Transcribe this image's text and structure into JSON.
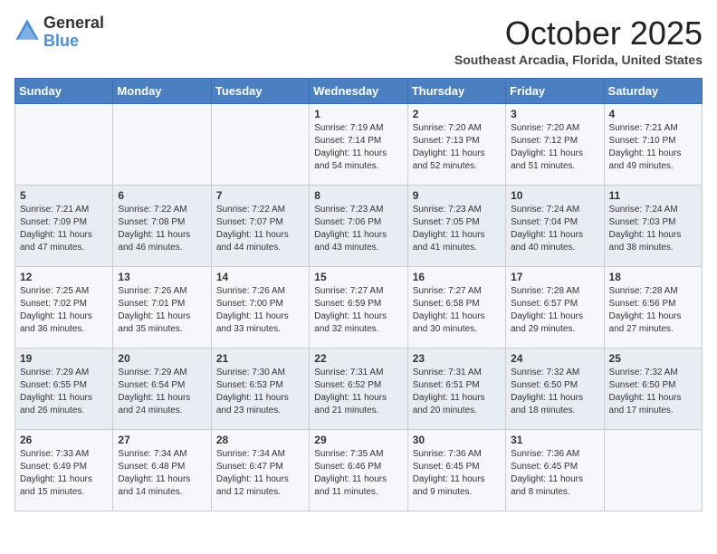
{
  "logo": {
    "general": "General",
    "blue": "Blue"
  },
  "title": "October 2025",
  "location": "Southeast Arcadia, Florida, United States",
  "days_of_week": [
    "Sunday",
    "Monday",
    "Tuesday",
    "Wednesday",
    "Thursday",
    "Friday",
    "Saturday"
  ],
  "weeks": [
    [
      {
        "day": "",
        "info": ""
      },
      {
        "day": "",
        "info": ""
      },
      {
        "day": "",
        "info": ""
      },
      {
        "day": "1",
        "info": "Sunrise: 7:19 AM\nSunset: 7:14 PM\nDaylight: 11 hours and 54 minutes."
      },
      {
        "day": "2",
        "info": "Sunrise: 7:20 AM\nSunset: 7:13 PM\nDaylight: 11 hours and 52 minutes."
      },
      {
        "day": "3",
        "info": "Sunrise: 7:20 AM\nSunset: 7:12 PM\nDaylight: 11 hours and 51 minutes."
      },
      {
        "day": "4",
        "info": "Sunrise: 7:21 AM\nSunset: 7:10 PM\nDaylight: 11 hours and 49 minutes."
      }
    ],
    [
      {
        "day": "5",
        "info": "Sunrise: 7:21 AM\nSunset: 7:09 PM\nDaylight: 11 hours and 47 minutes."
      },
      {
        "day": "6",
        "info": "Sunrise: 7:22 AM\nSunset: 7:08 PM\nDaylight: 11 hours and 46 minutes."
      },
      {
        "day": "7",
        "info": "Sunrise: 7:22 AM\nSunset: 7:07 PM\nDaylight: 11 hours and 44 minutes."
      },
      {
        "day": "8",
        "info": "Sunrise: 7:23 AM\nSunset: 7:06 PM\nDaylight: 11 hours and 43 minutes."
      },
      {
        "day": "9",
        "info": "Sunrise: 7:23 AM\nSunset: 7:05 PM\nDaylight: 11 hours and 41 minutes."
      },
      {
        "day": "10",
        "info": "Sunrise: 7:24 AM\nSunset: 7:04 PM\nDaylight: 11 hours and 40 minutes."
      },
      {
        "day": "11",
        "info": "Sunrise: 7:24 AM\nSunset: 7:03 PM\nDaylight: 11 hours and 38 minutes."
      }
    ],
    [
      {
        "day": "12",
        "info": "Sunrise: 7:25 AM\nSunset: 7:02 PM\nDaylight: 11 hours and 36 minutes."
      },
      {
        "day": "13",
        "info": "Sunrise: 7:26 AM\nSunset: 7:01 PM\nDaylight: 11 hours and 35 minutes."
      },
      {
        "day": "14",
        "info": "Sunrise: 7:26 AM\nSunset: 7:00 PM\nDaylight: 11 hours and 33 minutes."
      },
      {
        "day": "15",
        "info": "Sunrise: 7:27 AM\nSunset: 6:59 PM\nDaylight: 11 hours and 32 minutes."
      },
      {
        "day": "16",
        "info": "Sunrise: 7:27 AM\nSunset: 6:58 PM\nDaylight: 11 hours and 30 minutes."
      },
      {
        "day": "17",
        "info": "Sunrise: 7:28 AM\nSunset: 6:57 PM\nDaylight: 11 hours and 29 minutes."
      },
      {
        "day": "18",
        "info": "Sunrise: 7:28 AM\nSunset: 6:56 PM\nDaylight: 11 hours and 27 minutes."
      }
    ],
    [
      {
        "day": "19",
        "info": "Sunrise: 7:29 AM\nSunset: 6:55 PM\nDaylight: 11 hours and 26 minutes."
      },
      {
        "day": "20",
        "info": "Sunrise: 7:29 AM\nSunset: 6:54 PM\nDaylight: 11 hours and 24 minutes."
      },
      {
        "day": "21",
        "info": "Sunrise: 7:30 AM\nSunset: 6:53 PM\nDaylight: 11 hours and 23 minutes."
      },
      {
        "day": "22",
        "info": "Sunrise: 7:31 AM\nSunset: 6:52 PM\nDaylight: 11 hours and 21 minutes."
      },
      {
        "day": "23",
        "info": "Sunrise: 7:31 AM\nSunset: 6:51 PM\nDaylight: 11 hours and 20 minutes."
      },
      {
        "day": "24",
        "info": "Sunrise: 7:32 AM\nSunset: 6:50 PM\nDaylight: 11 hours and 18 minutes."
      },
      {
        "day": "25",
        "info": "Sunrise: 7:32 AM\nSunset: 6:50 PM\nDaylight: 11 hours and 17 minutes."
      }
    ],
    [
      {
        "day": "26",
        "info": "Sunrise: 7:33 AM\nSunset: 6:49 PM\nDaylight: 11 hours and 15 minutes."
      },
      {
        "day": "27",
        "info": "Sunrise: 7:34 AM\nSunset: 6:48 PM\nDaylight: 11 hours and 14 minutes."
      },
      {
        "day": "28",
        "info": "Sunrise: 7:34 AM\nSunset: 6:47 PM\nDaylight: 11 hours and 12 minutes."
      },
      {
        "day": "29",
        "info": "Sunrise: 7:35 AM\nSunset: 6:46 PM\nDaylight: 11 hours and 11 minutes."
      },
      {
        "day": "30",
        "info": "Sunrise: 7:36 AM\nSunset: 6:45 PM\nDaylight: 11 hours and 9 minutes."
      },
      {
        "day": "31",
        "info": "Sunrise: 7:36 AM\nSunset: 6:45 PM\nDaylight: 11 hours and 8 minutes."
      },
      {
        "day": "",
        "info": ""
      }
    ]
  ]
}
